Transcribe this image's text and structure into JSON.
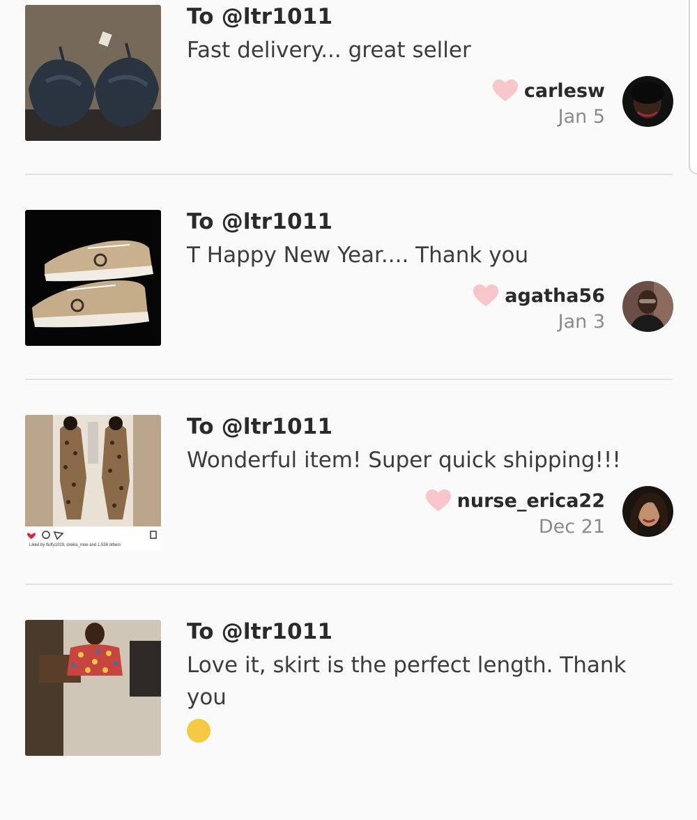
{
  "reviews": [
    {
      "to": "To @ltr1011",
      "message": "Fast delivery... great seller",
      "username": "carlesw",
      "date": "Jan 5",
      "thumb_icon": "bra-photo",
      "avatar_icon": "user-avatar"
    },
    {
      "to": "To @ltr1011",
      "message": "T Happy New Year.... Thank you",
      "username": "agatha56",
      "date": "Jan 3",
      "thumb_icon": "sneakers-photo",
      "avatar_icon": "user-avatar"
    },
    {
      "to": "To @ltr1011",
      "message": "Wonderful item! Super quick shipping!!!",
      "username": "nurse_erica22",
      "date": "Dec 21",
      "thumb_icon": "outfit-photo",
      "avatar_icon": "user-avatar",
      "thumb_caption": "Liked by fluffy1029, dreika_moe and 1,538 others"
    },
    {
      "to": "To @ltr1011",
      "message": "Love it, skirt is the perfect length. Thank you",
      "thumb_icon": "skirt-photo"
    }
  ],
  "colors": {
    "background": "#fafafa",
    "heart": "#f7c6cb",
    "divider": "#e2e2e2",
    "date": "#8a8a8a"
  }
}
